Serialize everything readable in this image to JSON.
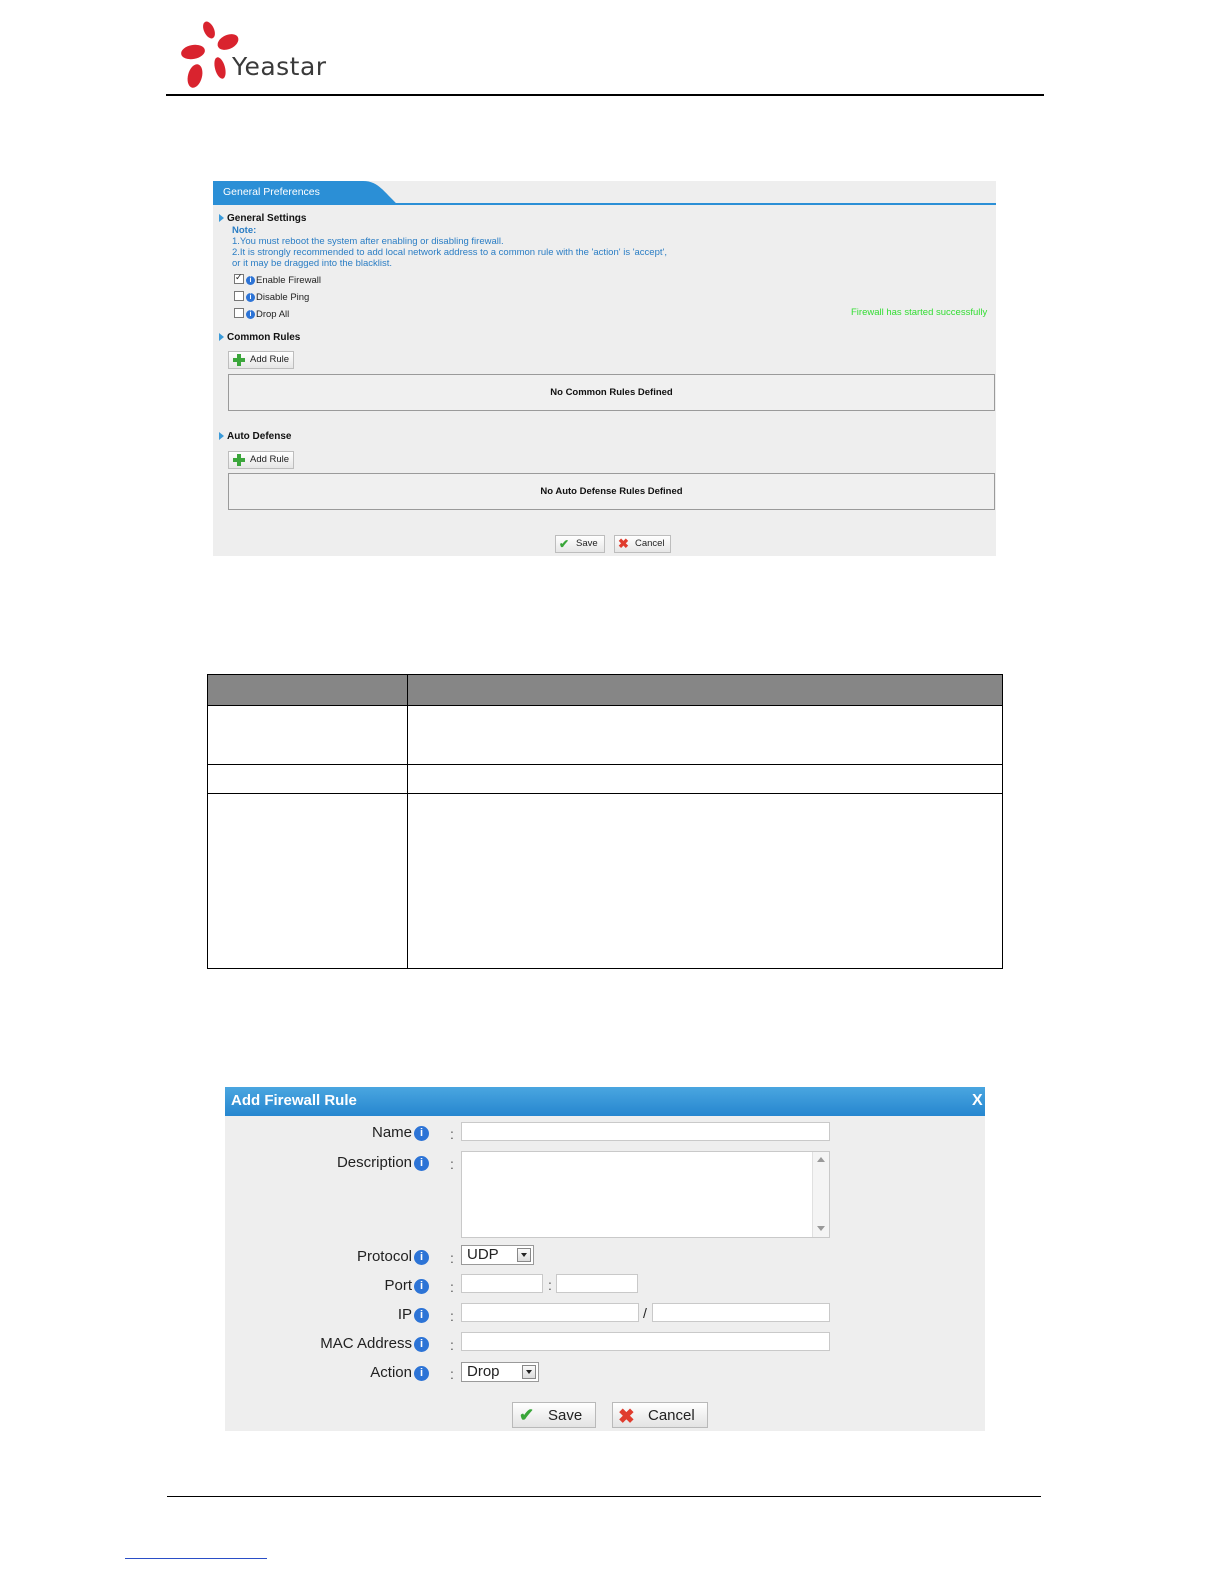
{
  "header": {
    "brand": "Yeastar",
    "colors": {
      "logo_red": "#d9232e"
    }
  },
  "general_preferences": {
    "tab_title": "General Preferences",
    "general_settings_heading": "General Settings",
    "note_label": "Note:",
    "note_line1": "1.You must reboot the system after enabling or disabling firewall.",
    "note_line2": "2.It is strongly recommended to add local network address to a common rule with the 'action' is 'accept',",
    "note_line3": "or it may be dragged into the blacklist.",
    "enable_firewall": {
      "label": "Enable Firewall",
      "checked": true
    },
    "disable_ping": {
      "label": "Disable Ping",
      "checked": false
    },
    "drop_all": {
      "label": "Drop All",
      "checked": false
    },
    "status_message": "Firewall has started successfully",
    "common_rules_heading": "Common Rules",
    "common_add_rule": "Add Rule",
    "common_empty": "No Common Rules Defined",
    "auto_defense_heading": "Auto Defense",
    "auto_add_rule": "Add Rule",
    "auto_empty": "No Auto Defense Rules Defined",
    "save": "Save",
    "cancel": "Cancel",
    "colors": {
      "tab_blue": "#2b8fd6",
      "status_green": "#33dd33",
      "note_blue": "#2a7dc4"
    }
  },
  "add_firewall_rule": {
    "title": "Add Firewall Rule",
    "close": "X",
    "name_label": "Name",
    "description_label": "Description",
    "protocol_label": "Protocol",
    "protocol_value": "UDP",
    "port_label": "Port",
    "port_separator": ":",
    "ip_label": "IP",
    "ip_separator": "/",
    "mac_label": "MAC Address",
    "action_label": "Action",
    "action_value": "Drop",
    "save": "Save",
    "cancel": "Cancel",
    "colors": {
      "title_blue": "#2686cf"
    }
  }
}
